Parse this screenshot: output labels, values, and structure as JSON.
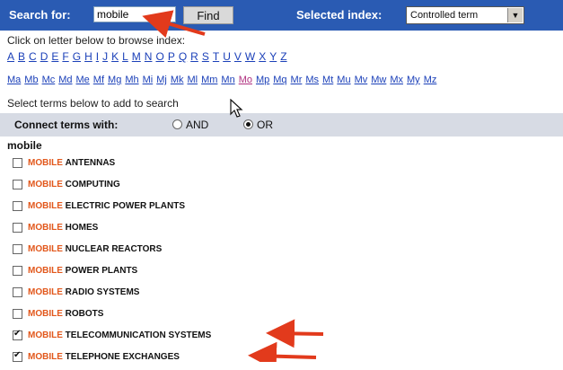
{
  "search": {
    "label": "Search for:",
    "value": "mobile",
    "find_label": "Find"
  },
  "index": {
    "label": "Selected index:",
    "selected": "Controlled term"
  },
  "browse": {
    "instruction": "Click on letter below to browse index:",
    "letters": [
      "A",
      "B",
      "C",
      "D",
      "E",
      "F",
      "G",
      "H",
      "I",
      "J",
      "K",
      "L",
      "M",
      "N",
      "O",
      "P",
      "Q",
      "R",
      "S",
      "T",
      "U",
      "V",
      "W",
      "X",
      "Y",
      "Z"
    ],
    "subletters": [
      "Ma",
      "Mb",
      "Mc",
      "Md",
      "Me",
      "Mf",
      "Mg",
      "Mh",
      "Mi",
      "Mj",
      "Mk",
      "Ml",
      "Mm",
      "Mn",
      "Mo",
      "Mp",
      "Mq",
      "Mr",
      "Ms",
      "Mt",
      "Mu",
      "Mv",
      "Mw",
      "Mx",
      "My",
      "Mz"
    ],
    "active_subletter": "Mo"
  },
  "connect": {
    "instruction": "Select terms below to add to search",
    "label": "Connect terms with:",
    "and_label": "AND",
    "or_label": "OR",
    "selected": "OR"
  },
  "terms": {
    "heading": "mobile",
    "keyword": "MOBILE",
    "items": [
      {
        "rest": "ANTENNAS",
        "checked": false
      },
      {
        "rest": "COMPUTING",
        "checked": false
      },
      {
        "rest": "ELECTRIC POWER PLANTS",
        "checked": false
      },
      {
        "rest": "HOMES",
        "checked": false
      },
      {
        "rest": "NUCLEAR REACTORS",
        "checked": false
      },
      {
        "rest": "POWER PLANTS",
        "checked": false
      },
      {
        "rest": "RADIO SYSTEMS",
        "checked": false
      },
      {
        "rest": "ROBOTS",
        "checked": false
      },
      {
        "rest": "TELECOMMUNICATION SYSTEMS",
        "checked": true
      },
      {
        "rest": "TELEPHONE EXCHANGES",
        "checked": true
      }
    ]
  },
  "colors": {
    "header": "#2a5bb3",
    "link": "#1a3fb8",
    "keyword": "#e2581c",
    "arrow": "#e23a1c",
    "connect_bar": "#d7dbe4"
  }
}
